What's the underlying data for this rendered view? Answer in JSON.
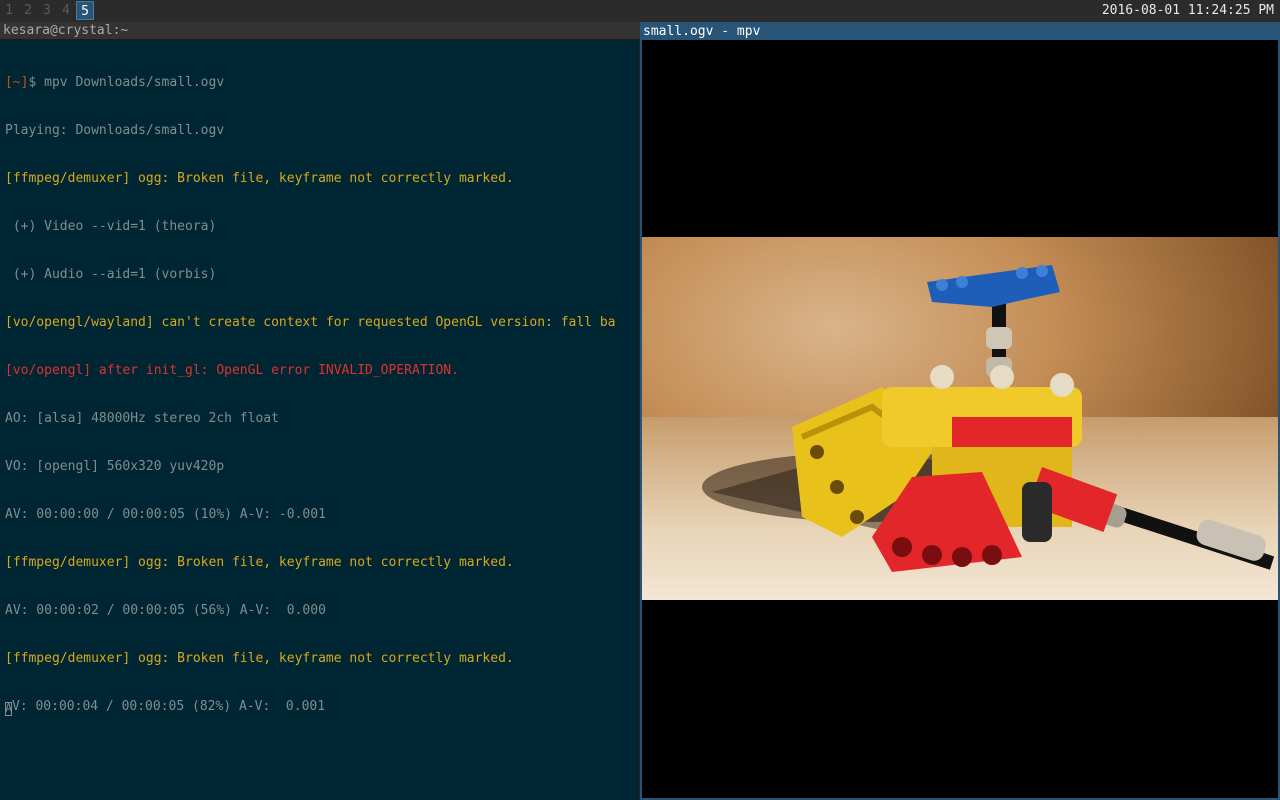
{
  "topbar": {
    "workspaces": [
      {
        "label": "1",
        "active": false
      },
      {
        "label": "2",
        "active": false
      },
      {
        "label": "3",
        "active": false
      },
      {
        "label": "4",
        "active": false
      },
      {
        "label": "5",
        "active": true
      }
    ],
    "clock": "2016-08-01 11:24:25 PM"
  },
  "terminal": {
    "title": "kesara@crystal:~",
    "prompt_dir": "[~]",
    "prompt_sign": "$ ",
    "command": "mpv Downloads/small.ogv",
    "lines": [
      {
        "text": "Playing: Downloads/small.ogv",
        "kind": "default"
      },
      {
        "text": "[ffmpeg/demuxer] ogg: Broken file, keyframe not correctly marked.",
        "kind": "warn"
      },
      {
        "text": " (+) Video --vid=1 (theora)",
        "kind": "default"
      },
      {
        "text": " (+) Audio --aid=1 (vorbis)",
        "kind": "default"
      },
      {
        "text": "[vo/opengl/wayland] can't create context for requested OpenGL version: fall ba",
        "kind": "warn"
      },
      {
        "text": "[vo/opengl] after init_gl: OpenGL error INVALID_OPERATION.",
        "kind": "err"
      },
      {
        "text": "AO: [alsa] 48000Hz stereo 2ch float",
        "kind": "default"
      },
      {
        "text": "VO: [opengl] 560x320 yuv420p",
        "kind": "default"
      },
      {
        "text": "AV: 00:00:00 / 00:00:05 (10%) A-V: -0.001",
        "kind": "default"
      },
      {
        "text": "[ffmpeg/demuxer] ogg: Broken file, keyframe not correctly marked.",
        "kind": "warn"
      },
      {
        "text": "AV: 00:00:02 / 00:00:05 (56%) A-V:  0.000",
        "kind": "default"
      },
      {
        "text": "[ffmpeg/demuxer] ogg: Broken file, keyframe not correctly marked.",
        "kind": "warn"
      }
    ],
    "last_line": "V: 00:00:04 / 00:00:05 (82%) A-V:  0.001",
    "last_line_cursor_char": "A"
  },
  "mpv": {
    "title": "small.ogv - mpv"
  },
  "colors": {
    "terminal_bg": "#002633",
    "focused_title": "#285577",
    "warn": "#d8a71a",
    "error": "#dc322f",
    "prompt": "#cb4b16"
  }
}
